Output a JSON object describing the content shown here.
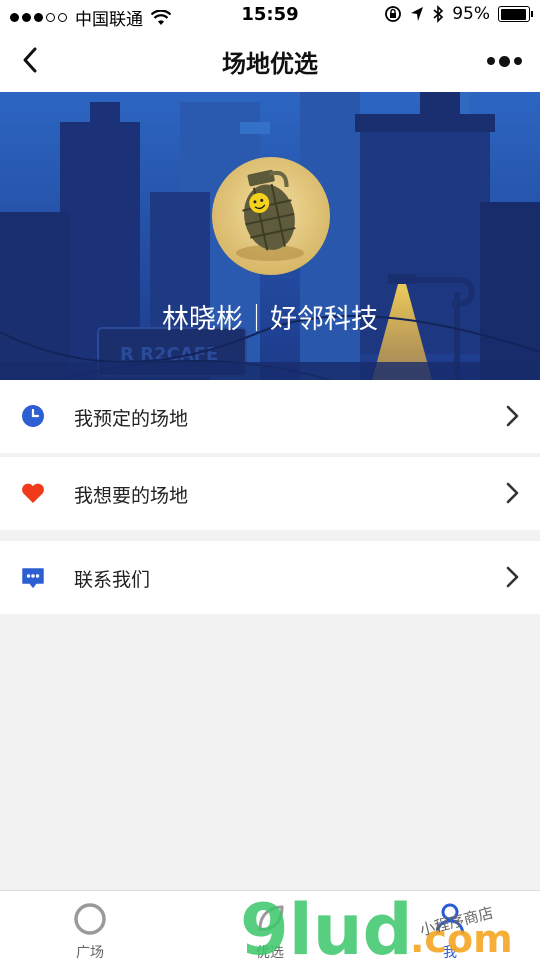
{
  "status_bar": {
    "carrier": "中国联通",
    "time": "15:59",
    "battery": "95%",
    "battery_level": 0.95
  },
  "nav": {
    "title": "场地优选"
  },
  "profile": {
    "name": "林晓彬｜好邻科技"
  },
  "menu": {
    "group1": [
      {
        "label": "我预定的场地",
        "icon": "clock-icon",
        "color": "#2d5fd3"
      },
      {
        "label": "我想要的场地",
        "icon": "heart-icon",
        "color": "#f03a1c"
      }
    ],
    "group2": [
      {
        "label": "联系我们",
        "icon": "chat-bubble-icon",
        "color": "#2d5fd3"
      }
    ]
  },
  "tabs": [
    {
      "label": "广场",
      "icon": "ring-icon"
    },
    {
      "label": "优选",
      "icon": "leaf-icon"
    },
    {
      "label": "我",
      "icon": "person-icon",
      "active": true
    }
  ],
  "watermark": {
    "main": "9lud",
    "suffix": ".com",
    "script": "小程序商店"
  },
  "colors": {
    "accent": "#2a5bd7",
    "banner": "#203a8c",
    "heart": "#f03a1c"
  }
}
